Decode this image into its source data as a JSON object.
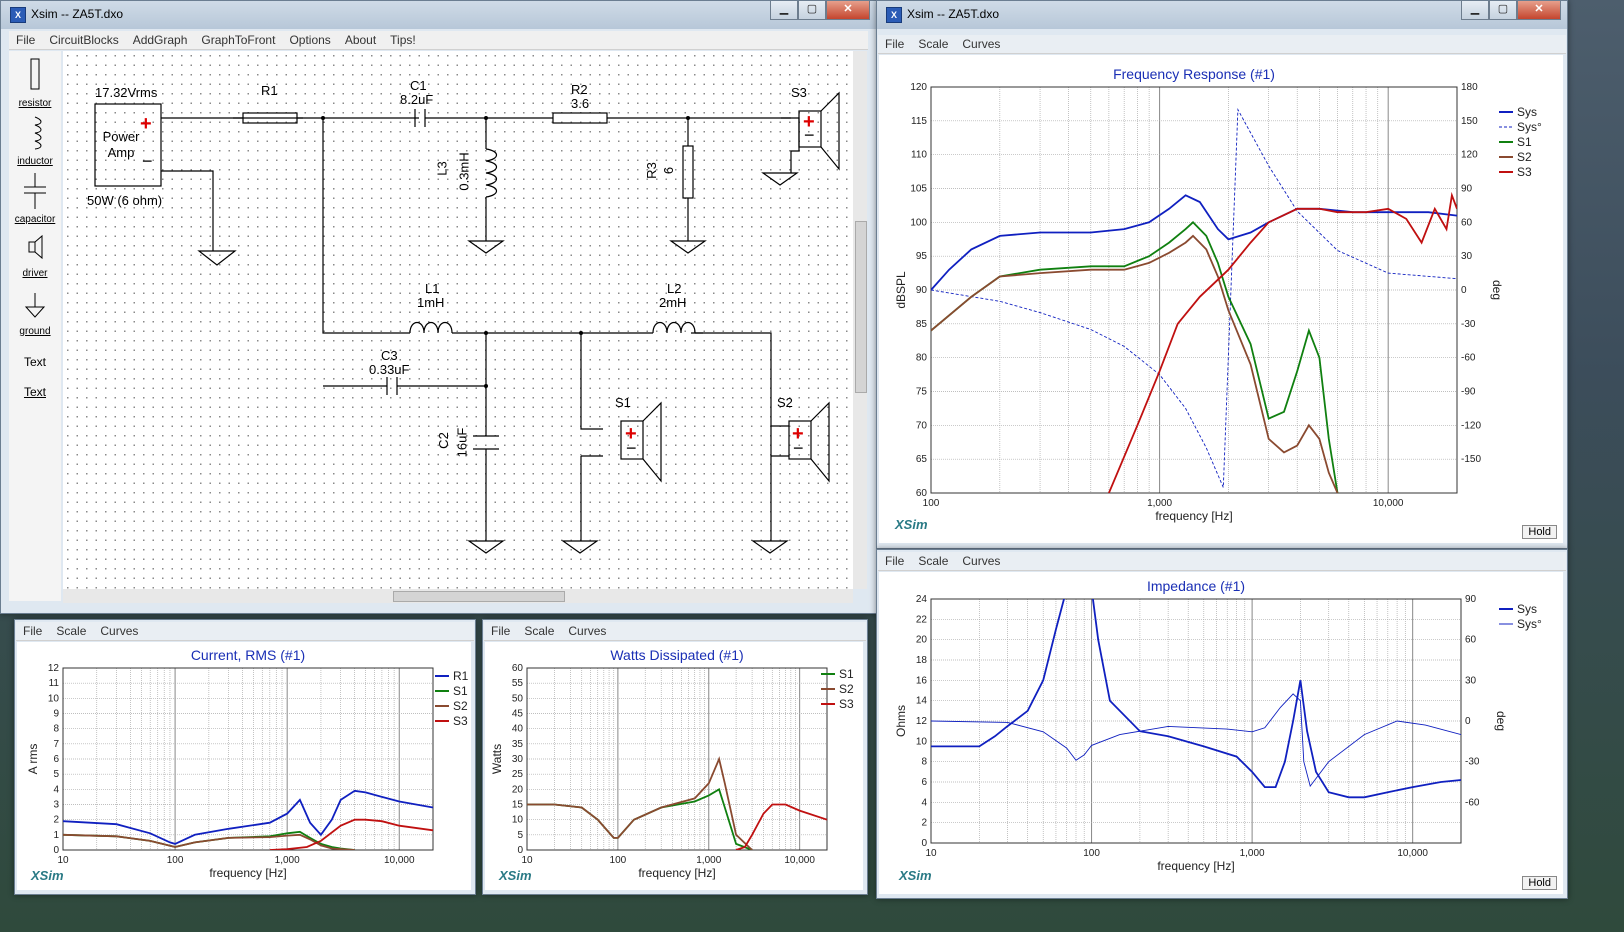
{
  "schematic_window": {
    "title": "Xsim -- ZA5T.dxo",
    "menu": [
      "File",
      "CircuitBlocks",
      "AddGraph",
      "GraphToFront",
      "Options",
      "About",
      "Tips!"
    ],
    "tools": [
      {
        "label": "resistor",
        "icon": "resistor-icon"
      },
      {
        "label": "inductor",
        "icon": "inductor-icon"
      },
      {
        "label": "capacitor",
        "icon": "capacitor-icon"
      },
      {
        "label": "driver",
        "icon": "driver-icon"
      },
      {
        "label": "ground",
        "icon": "ground-icon"
      },
      {
        "label": "Text",
        "icon": "text-icon"
      },
      {
        "label": "Text",
        "icon": "text-icon"
      }
    ],
    "circuit": {
      "source_voltage": "17.32Vrms",
      "source_name": "Power Amp",
      "source_power": "50W (6 ohm)",
      "plus": "+",
      "minus": "−",
      "R1": "R1",
      "C1": "C1",
      "C1_val": "8.2uF",
      "R2": "R2",
      "R2_val": "3.6",
      "L3": "L3",
      "L3_val": "0.3mH",
      "R3": "R3",
      "R3_val": "6",
      "S3": "S3",
      "L1": "L1",
      "L1_val": "1mH",
      "L2": "L2",
      "L2_val": "2mH",
      "C3": "C3",
      "C3_val": "0.33uF",
      "C2": "C2",
      "C2_val": "16uF",
      "S1": "S1",
      "S2": "S2"
    }
  },
  "freq_window": {
    "title": "Xsim -- ZA5T.dxo",
    "menu": [
      "File",
      "Scale",
      "Curves"
    ],
    "brand": "XSim",
    "hold": "Hold",
    "chart_data": {
      "type": "line",
      "title": "Frequency Response (#1)",
      "xlabel": "frequency [Hz]",
      "ylabel": "dBSPL",
      "y2label": "deg",
      "xscale": "log",
      "xlim": [
        100,
        20000
      ],
      "ylim": [
        60,
        120
      ],
      "y2lim": [
        -180,
        180
      ],
      "x_ticks": [
        "100",
        "1,000",
        "10,000"
      ],
      "y_ticks": [
        "60",
        "65",
        "70",
        "75",
        "80",
        "85",
        "90",
        "95",
        "100",
        "105",
        "110",
        "115",
        "120"
      ],
      "y2_ticks": [
        "-150",
        "-120",
        "-90",
        "-60",
        "-30",
        "0",
        "30",
        "60",
        "90",
        "120",
        "150",
        "180"
      ],
      "series": [
        {
          "name": "Sys",
          "color": "#1020c0",
          "style": "solid",
          "x": [
            100,
            120,
            150,
            200,
            300,
            500,
            700,
            900,
            1100,
            1300,
            1500,
            1800,
            2000,
            2500,
            3000,
            4000,
            5000,
            7000,
            10000,
            15000,
            20000
          ],
          "y": [
            90,
            93,
            96,
            98,
            98.5,
            98.5,
            99,
            100,
            102,
            104,
            103,
            99,
            97.5,
            98.5,
            100,
            102,
            102,
            101.5,
            101.5,
            101.5,
            101
          ]
        },
        {
          "name": "Sys°",
          "color": "#1020c0",
          "style": "dashed",
          "x": [
            100,
            200,
            300,
            500,
            700,
            1000,
            1300,
            1600,
            1900,
            2200,
            3000,
            4000,
            6000,
            10000,
            20000
          ],
          "y": [
            0,
            -10,
            -20,
            -35,
            -50,
            -75,
            -105,
            -140,
            -175,
            160,
            110,
            70,
            35,
            15,
            10
          ]
        },
        {
          "name": "S1",
          "color": "#108010",
          "style": "solid",
          "x": [
            100,
            150,
            200,
            300,
            500,
            700,
            900,
            1100,
            1300,
            1400,
            1600,
            1800,
            2000,
            2500,
            3000,
            3500,
            4000,
            4500,
            5000,
            5500,
            6000
          ],
          "y": [
            84,
            89,
            92,
            93,
            93.5,
            93.5,
            95,
            97,
            99,
            100,
            98,
            94,
            89,
            82,
            71,
            72,
            78,
            84,
            80,
            68,
            60
          ]
        },
        {
          "name": "S2",
          "color": "#8a4a30",
          "style": "solid",
          "x": [
            100,
            150,
            200,
            300,
            500,
            700,
            900,
            1100,
            1300,
            1400,
            1600,
            1800,
            2000,
            2500,
            3000,
            3500,
            4000,
            4500,
            5000,
            5500,
            6000
          ],
          "y": [
            84,
            89,
            92,
            92.5,
            93,
            93,
            94,
            95.5,
            97,
            98,
            96,
            92,
            87,
            79,
            68,
            66,
            67,
            70,
            68,
            63,
            60
          ]
        },
        {
          "name": "S3",
          "color": "#c01010",
          "style": "solid",
          "x": [
            600,
            800,
            1000,
            1200,
            1500,
            2000,
            2500,
            3000,
            4000,
            5000,
            6000,
            8000,
            10000,
            12000,
            14000,
            16000,
            18000,
            19000,
            20000
          ],
          "y": [
            60,
            70,
            78,
            85,
            89,
            93,
            97,
            100,
            102,
            102,
            101.5,
            101.5,
            102,
            100.5,
            97,
            102,
            99,
            104,
            102
          ]
        }
      ]
    },
    "legend": [
      "Sys",
      "Sys°",
      "S1",
      "S2",
      "S3"
    ]
  },
  "impedance_window": {
    "menu": [
      "File",
      "Scale",
      "Curves"
    ],
    "brand": "XSim",
    "hold": "Hold",
    "chart_data": {
      "type": "line",
      "title": "Impedance (#1)",
      "xlabel": "frequency [Hz]",
      "ylabel": "Ohms",
      "y2label": "deg",
      "xscale": "log",
      "xlim": [
        10,
        20000
      ],
      "ylim": [
        0,
        24
      ],
      "y2lim": [
        -90,
        90
      ],
      "x_ticks": [
        "10",
        "100",
        "1,000",
        "10,000"
      ],
      "y_ticks": [
        "0",
        "2",
        "4",
        "6",
        "8",
        "10",
        "12",
        "14",
        "16",
        "18",
        "20",
        "22",
        "24"
      ],
      "y2_ticks": [
        "-60",
        "-30",
        "0",
        "30",
        "60",
        "90"
      ],
      "series": [
        {
          "name": "Sys",
          "color": "#1020c0",
          "style": "solid",
          "x": [
            10,
            20,
            25,
            30,
            40,
            50,
            60,
            70,
            80,
            90,
            100,
            110,
            130,
            200,
            300,
            500,
            800,
            1000,
            1200,
            1400,
            1600,
            1800,
            2000,
            2200,
            2500,
            3000,
            4000,
            5000,
            7000,
            10000,
            15000,
            20000
          ],
          "y": [
            9.5,
            9.5,
            10.5,
            11.5,
            13,
            16,
            21,
            25,
            25,
            25,
            25,
            20,
            14,
            11,
            10.5,
            9.5,
            8.5,
            7,
            5.5,
            5.5,
            8,
            12,
            16,
            11,
            7,
            5,
            4.5,
            4.5,
            5,
            5.5,
            6,
            6.2
          ]
        },
        {
          "name": "Sys°",
          "color": "#1020c0",
          "style": "thin",
          "x": [
            10,
            30,
            50,
            70,
            80,
            90,
            100,
            150,
            300,
            700,
            1000,
            1200,
            1500,
            1800,
            2000,
            2100,
            2300,
            3000,
            5000,
            8000,
            12000,
            20000
          ],
          "y": [
            0,
            -1,
            -8,
            -20,
            -29,
            -25,
            -18,
            -10,
            -4,
            -6,
            -8,
            -5,
            10,
            20,
            15,
            -30,
            -48,
            -30,
            -10,
            0,
            -3,
            -10
          ]
        }
      ]
    },
    "legend": [
      "Sys",
      "Sys°"
    ]
  },
  "current_window": {
    "menu": [
      "File",
      "Scale",
      "Curves"
    ],
    "brand": "XSim",
    "chart_data": {
      "type": "line",
      "title": "Current, RMS (#1)",
      "xlabel": "frequency [Hz]",
      "ylabel": "A rms",
      "xscale": "log",
      "xlim": [
        10,
        20000
      ],
      "ylim": [
        0,
        12
      ],
      "x_ticks": [
        "10",
        "100",
        "1,000",
        "10,000"
      ],
      "y_ticks": [
        "0",
        "1",
        "2",
        "3",
        "4",
        "5",
        "6",
        "7",
        "8",
        "9",
        "10",
        "11",
        "12"
      ],
      "series": [
        {
          "name": "R1",
          "color": "#1020c0",
          "x": [
            10,
            30,
            60,
            90,
            100,
            150,
            300,
            700,
            1000,
            1300,
            1600,
            2000,
            2500,
            3000,
            4000,
            5000,
            7000,
            10000,
            20000
          ],
          "y": [
            1.9,
            1.7,
            1.1,
            0.5,
            0.4,
            1.0,
            1.4,
            1.8,
            2.4,
            3.3,
            1.8,
            1.0,
            2.0,
            3.3,
            3.9,
            3.8,
            3.5,
            3.2,
            2.8
          ]
        },
        {
          "name": "S1",
          "color": "#108010",
          "x": [
            10,
            30,
            60,
            100,
            150,
            300,
            700,
            1000,
            1300,
            1600,
            2000,
            2500,
            3000,
            4000
          ],
          "y": [
            1.0,
            0.9,
            0.6,
            0.2,
            0.5,
            0.8,
            0.9,
            1.1,
            1.2,
            0.8,
            0.4,
            0.2,
            0.1,
            0
          ]
        },
        {
          "name": "S2",
          "color": "#8a4a30",
          "x": [
            10,
            30,
            60,
            100,
            150,
            300,
            700,
            1000,
            1300,
            1600,
            2000,
            2500,
            3000,
            4000
          ],
          "y": [
            1.0,
            0.9,
            0.6,
            0.2,
            0.5,
            0.8,
            0.85,
            0.95,
            1.0,
            0.7,
            0.3,
            0.1,
            0.05,
            0
          ]
        },
        {
          "name": "S3",
          "color": "#c01010",
          "x": [
            700,
            1000,
            1500,
            2000,
            3000,
            4000,
            5000,
            7000,
            10000,
            20000
          ],
          "y": [
            0,
            0.05,
            0.2,
            0.6,
            1.6,
            2.0,
            2.0,
            1.9,
            1.6,
            1.3
          ]
        }
      ]
    },
    "legend": [
      "R1",
      "S1",
      "S2",
      "S3"
    ]
  },
  "watts_window": {
    "menu": [
      "File",
      "Scale",
      "Curves"
    ],
    "brand": "XSim",
    "chart_data": {
      "type": "line",
      "title": "Watts Dissipated (#1)",
      "xlabel": "frequency [Hz]",
      "ylabel": "Watts",
      "xscale": "log",
      "xlim": [
        10,
        20000
      ],
      "ylim": [
        0,
        60
      ],
      "x_ticks": [
        "10",
        "100",
        "1,000",
        "10,000"
      ],
      "y_ticks": [
        "0",
        "5",
        "10",
        "15",
        "20",
        "25",
        "30",
        "35",
        "40",
        "45",
        "50",
        "55",
        "60"
      ],
      "series": [
        {
          "name": "S1",
          "color": "#108010",
          "x": [
            10,
            20,
            40,
            60,
            90,
            100,
            150,
            300,
            700,
            1000,
            1300,
            1500,
            2000,
            3000
          ],
          "y": [
            15,
            15,
            14,
            10,
            4,
            4,
            10,
            14,
            16,
            18,
            20,
            14,
            2,
            0
          ]
        },
        {
          "name": "S2",
          "color": "#8a4a30",
          "x": [
            10,
            20,
            40,
            60,
            90,
            100,
            150,
            300,
            700,
            1000,
            1300,
            1500,
            2000,
            3000
          ],
          "y": [
            15,
            15,
            14,
            10,
            4,
            4,
            10,
            14,
            17,
            22,
            30,
            22,
            5,
            0
          ]
        },
        {
          "name": "S3",
          "color": "#c01010",
          "x": [
            2000,
            2500,
            3000,
            4000,
            5000,
            7000,
            10000,
            20000
          ],
          "y": [
            0,
            1,
            5,
            12,
            15,
            15,
            13,
            10
          ]
        }
      ]
    },
    "legend": [
      "S1",
      "S2",
      "S3"
    ]
  }
}
